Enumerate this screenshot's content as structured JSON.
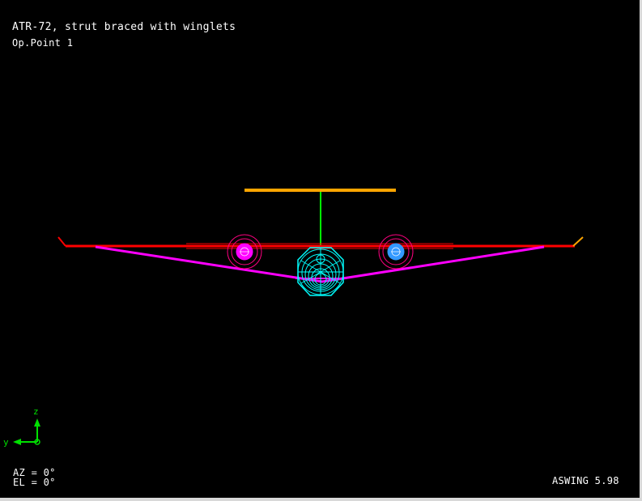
{
  "header": {
    "title": "ATR-72, strut braced with winglets",
    "subtitle": "Op.Point 1"
  },
  "view": {
    "azimuth": "AZ = 0°",
    "elevation": "EL = 0°"
  },
  "axes": {
    "z_label": "z",
    "y_label": "y",
    "color": "#00e000"
  },
  "footer": {
    "version": "ASWING 5.98"
  },
  "colors": {
    "background": "#000000",
    "wing": "#ff0000",
    "strut": "#ff00ff",
    "fin": "#00ff00",
    "tailplane": "#ffa500",
    "fuselage": "#00ffff",
    "left_engine": "#ff00ff",
    "right_engine": "#3399ff",
    "engine_ring": "#ff0080"
  }
}
